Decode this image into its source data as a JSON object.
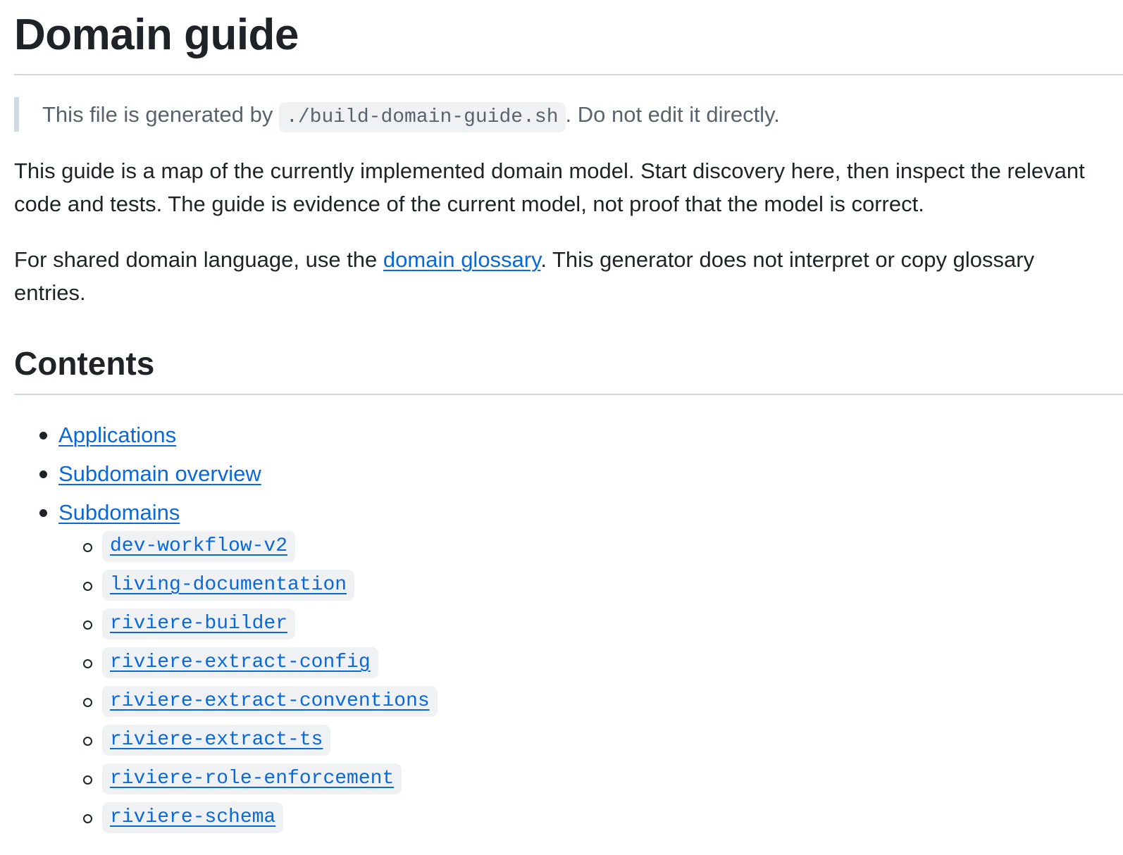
{
  "title": "Domain guide",
  "notice": {
    "prefix": "This file is generated by",
    "code": "./build-domain-guide.sh",
    "suffix": ". Do not edit it directly."
  },
  "intro": "This guide is a map of the currently implemented domain model. Start discovery here, then inspect the relevant code and tests. The guide is evidence of the current model, not proof that the model is correct.",
  "glossary_paragraph": {
    "prefix": "For shared domain language, use the ",
    "link_text": "domain glossary",
    "suffix": ". This generator does not interpret or copy glossary entries."
  },
  "contents": {
    "heading": "Contents",
    "items": [
      {
        "label": "Applications"
      },
      {
        "label": "Subdomain overview"
      },
      {
        "label": "Subdomains"
      }
    ],
    "subdomains": [
      {
        "label": "dev-workflow-v2"
      },
      {
        "label": "living-documentation"
      },
      {
        "label": "riviere-builder"
      },
      {
        "label": "riviere-extract-config"
      },
      {
        "label": "riviere-extract-conventions"
      },
      {
        "label": "riviere-extract-ts"
      },
      {
        "label": "riviere-role-enforcement"
      },
      {
        "label": "riviere-schema"
      }
    ]
  }
}
